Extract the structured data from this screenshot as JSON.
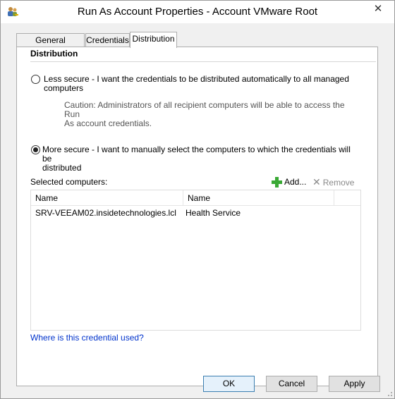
{
  "window": {
    "title": "Run As Account Properties - Account VMware Root",
    "close_glyph": "✕"
  },
  "tabs": [
    {
      "label": "General Properties",
      "selected": false
    },
    {
      "label": "Credentials",
      "selected": false
    },
    {
      "label": "Distribution",
      "selected": true
    }
  ],
  "distribution": {
    "section_title": "Distribution",
    "option_less": {
      "label_line1": "Less secure - I want the credentials to be distributed automatically to all managed",
      "label_line2": "computers",
      "checked": false
    },
    "caution_line1": "Caution: Administrators of all recipient computers will be able to access the Run",
    "caution_line2": "As account credentials.",
    "option_more": {
      "label_line1": "More secure - I want to manually select the computers to which the credentials will be",
      "label_line2": "distributed",
      "checked": true
    },
    "selected_label": "Selected computers:",
    "add_label": "Add...",
    "remove_label": "Remove",
    "table": {
      "columns": [
        "Name",
        "Name"
      ],
      "rows": [
        [
          "SRV-VEEAM02.insidetechnologies.lcl",
          "Health Service"
        ]
      ]
    },
    "help_link": "Where is this credential used?"
  },
  "buttons": {
    "ok": "OK",
    "cancel": "Cancel",
    "apply": "Apply"
  },
  "icons": {
    "app": "user-group-key-icon",
    "add": "green-plus-icon",
    "remove": "x-icon"
  },
  "colors": {
    "link": "#0033cc",
    "add_icon": "#3aa935"
  }
}
